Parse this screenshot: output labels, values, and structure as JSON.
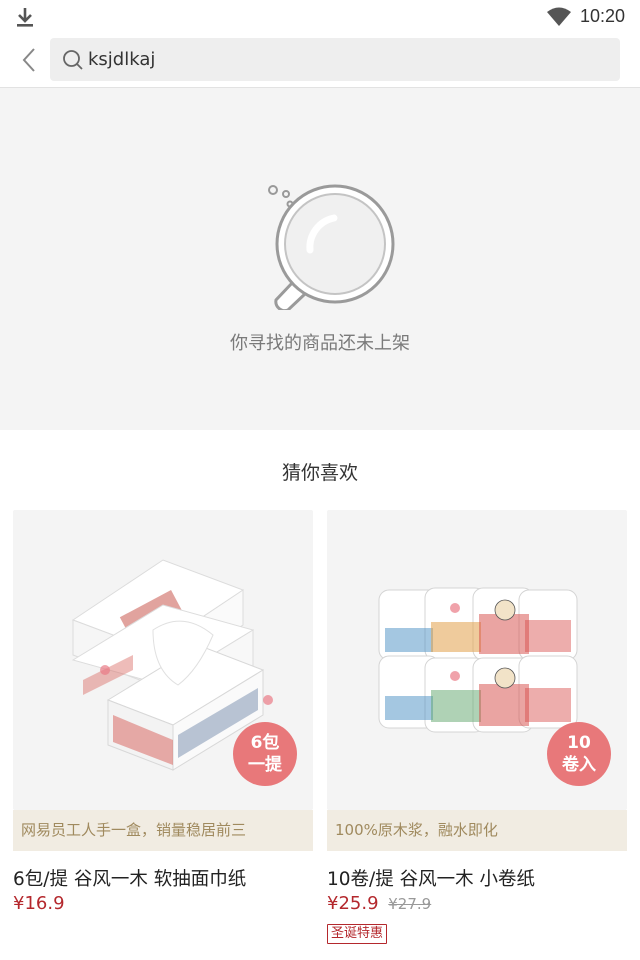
{
  "status_bar": {
    "time": "10:20",
    "download_icon": "download-icon",
    "wifi_icon": "wifi-icon"
  },
  "search": {
    "query": "ksjdlkaj",
    "back_icon": "chevron-left-icon",
    "search_icon": "search-icon"
  },
  "empty_state": {
    "message": "你寻找的商品还未上架",
    "illustration": "magnifier-illustration"
  },
  "recommend": {
    "title": "猜你喜欢",
    "products": [
      {
        "badge_line1": "6包",
        "badge_line2": "一提",
        "promo": "网易员工人手一盒，销量稳居前三",
        "name": "6包/提 谷风一木 软抽面巾纸",
        "price": "¥16.9"
      },
      {
        "badge_line1": "10",
        "badge_line2": "卷入",
        "promo": "100%原木浆，融水即化",
        "name": "10卷/提 谷风一木 小卷纸",
        "price": "¥25.9",
        "original_price": "¥27.9",
        "tag": "圣诞特惠"
      }
    ]
  },
  "colors": {
    "accent": "#b4282d",
    "badge": "#e8787a",
    "promo_bg": "#f1ece2",
    "promo_text": "#a08a5e",
    "empty_bg": "#f4f4f4"
  }
}
